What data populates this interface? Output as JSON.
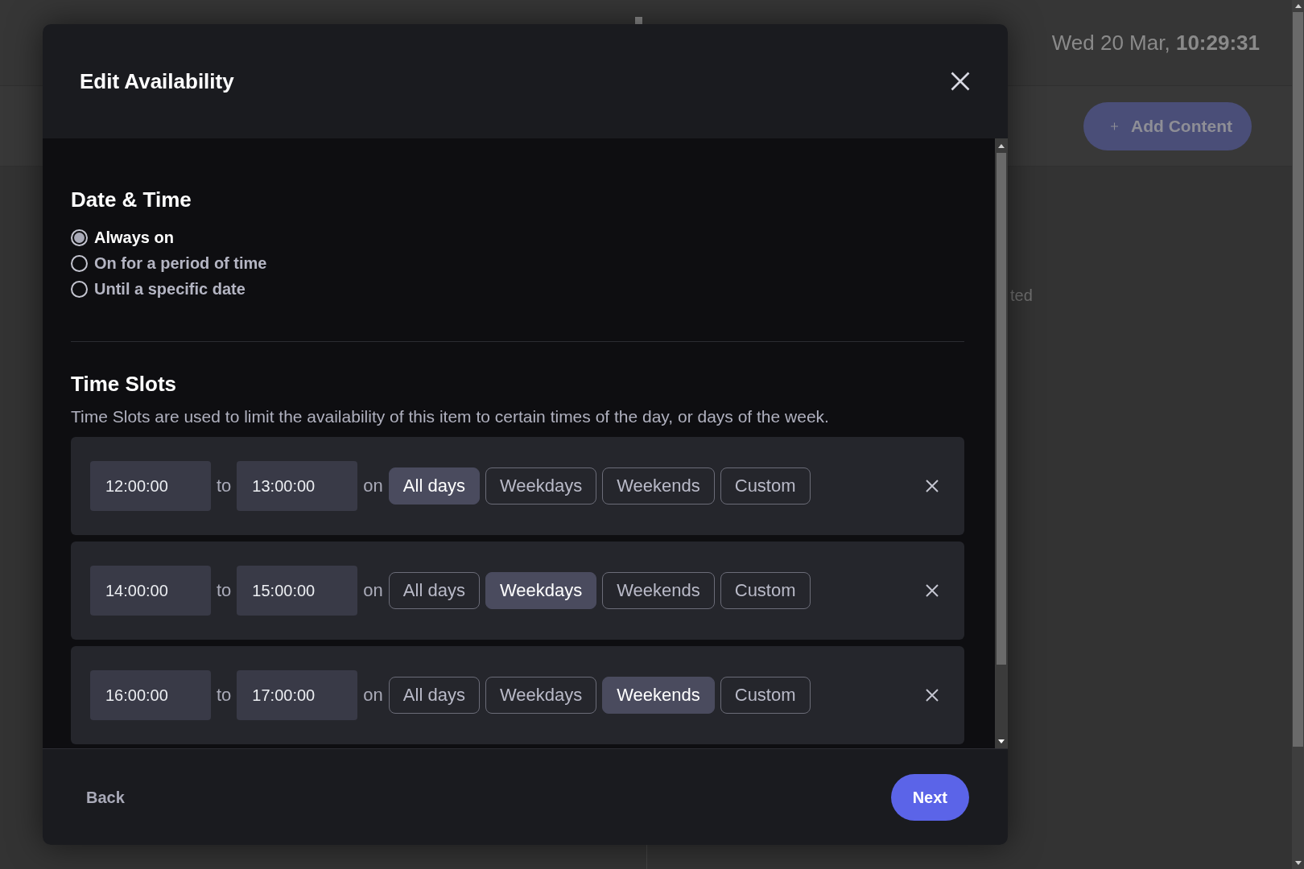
{
  "background": {
    "datetime": "Wed 20 Mar, **10:29:31**",
    "add_button": "Add Content",
    "caption": "ted"
  },
  "dialog": {
    "title": "Edit Availability",
    "date_time": {
      "heading": "Date & Time",
      "options": [
        {
          "label": "Always on",
          "selected": true
        },
        {
          "label": "On for a period of time",
          "selected": false
        },
        {
          "label": "Until a specific date",
          "selected": false
        }
      ]
    },
    "time_slots": {
      "heading": "Time Slots",
      "description": "Time Slots are used to limit the availability of this item to certain times of the day, or days of the week.",
      "slots": [
        {
          "start": "12:00:00",
          "separator": "to",
          "end": "13:00:00",
          "days_label": "on",
          "days": [
            {
              "label": "All days",
              "selected": true
            },
            {
              "label": "Weekdays",
              "selected": false
            },
            {
              "label": "Weekends",
              "selected": false
            },
            {
              "label": "Custom",
              "selected": false
            }
          ]
        },
        {
          "start": "14:00:00",
          "separator": "to",
          "end": "15:00:00",
          "days_label": "on",
          "days": [
            {
              "label": "All days",
              "selected": false
            },
            {
              "label": "Weekdays",
              "selected": true
            },
            {
              "label": "Weekends",
              "selected": false
            },
            {
              "label": "Custom",
              "selected": false
            }
          ]
        },
        {
          "start": "16:00:00",
          "separator": "to",
          "end": "17:00:00",
          "days_label": "on",
          "days": [
            {
              "label": "All days",
              "selected": false
            },
            {
              "label": "Weekdays",
              "selected": false
            },
            {
              "label": "Weekends",
              "selected": true
            },
            {
              "label": "Custom",
              "selected": false
            }
          ]
        }
      ]
    },
    "footer": {
      "back": "Back",
      "next": "Next"
    }
  }
}
